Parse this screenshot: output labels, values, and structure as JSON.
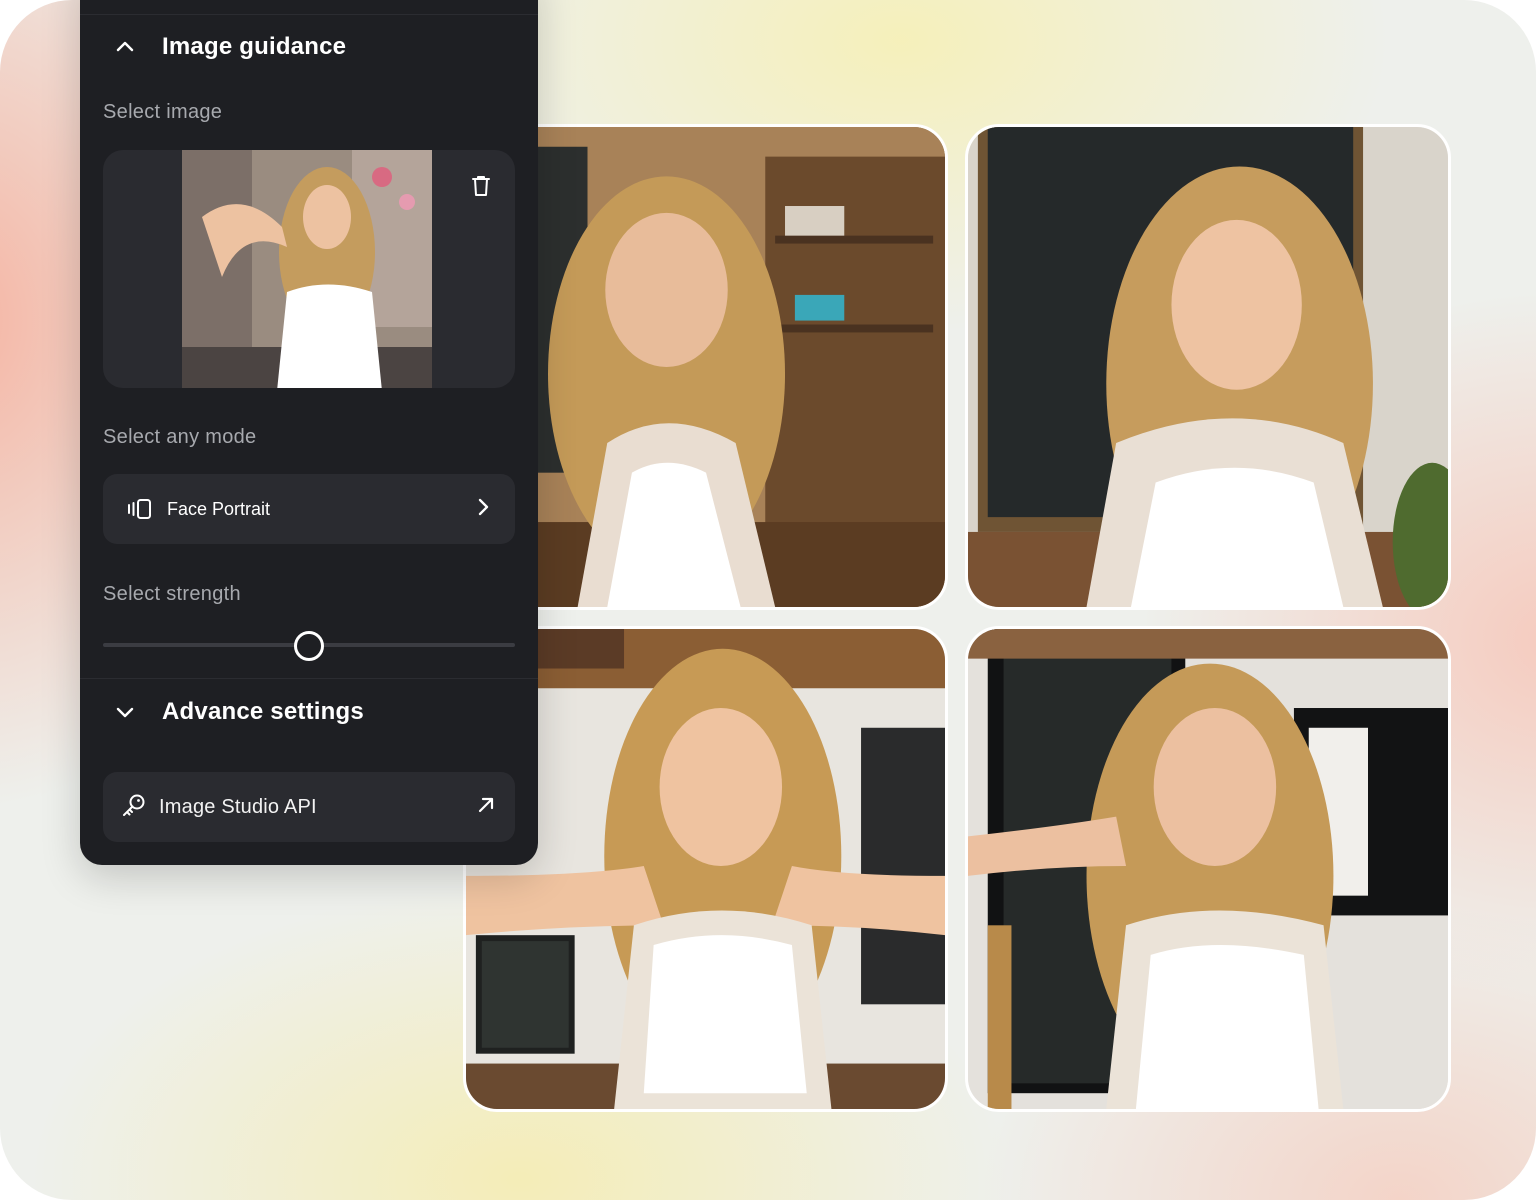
{
  "panel": {
    "section_title": "Image guidance",
    "select_image_label": "Select image",
    "select_mode_label": "Select any mode",
    "mode_value": "Face Portrait",
    "select_strength_label": "Select strength",
    "strength_value": 0.5,
    "advanced_title": "Advance settings",
    "api_label": "Image Studio API"
  },
  "icons": {
    "section_collapse": "chevron-up-icon",
    "advanced_expand": "chevron-down-icon",
    "delete": "trash-icon",
    "mode": "portrait-mode-icon",
    "mode_next": "chevron-right-icon",
    "api": "key-icon",
    "api_open": "external-arrow-icon"
  },
  "colors": {
    "panel_bg": "#1e1f23",
    "control_bg": "#2a2b30",
    "label_text": "#a7a9ae"
  }
}
